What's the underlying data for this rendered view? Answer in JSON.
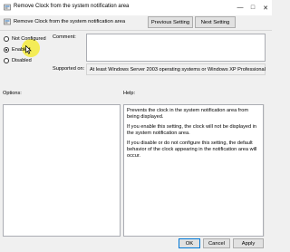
{
  "window": {
    "title": "Remove Clock from the system notification area",
    "subtitle": "Remove Clock from the system notification area",
    "minimize_glyph": "—",
    "maximize_glyph": "□",
    "close_glyph": "✕"
  },
  "nav": {
    "previous_label": "Previous Setting",
    "next_label": "Next Setting"
  },
  "state": {
    "options": [
      {
        "label": "Not Configured",
        "checked": false
      },
      {
        "label": "Enabled",
        "checked": true
      },
      {
        "label": "Disabled",
        "checked": false
      }
    ]
  },
  "comment": {
    "label": "Comment:",
    "value": ""
  },
  "supported": {
    "label": "Supported on:",
    "value": "At least Windows Server 2003 operating systems or Windows XP Professional"
  },
  "options_panel": {
    "label": "Options:"
  },
  "help_panel": {
    "label": "Help:",
    "paragraphs": [
      "Prevents the clock in the system notification area from being displayed.",
      "If you enable this setting, the clock will not be displayed in the system notification area.",
      "If you disable or do not configure this setting, the default behavior of the clock appearing in the notification area will occur."
    ]
  },
  "footer": {
    "ok_label": "OK",
    "cancel_label": "Cancel",
    "apply_label": "Apply"
  },
  "colors": {
    "highlight": "#f5eb3c",
    "accent": "#0078d7"
  }
}
